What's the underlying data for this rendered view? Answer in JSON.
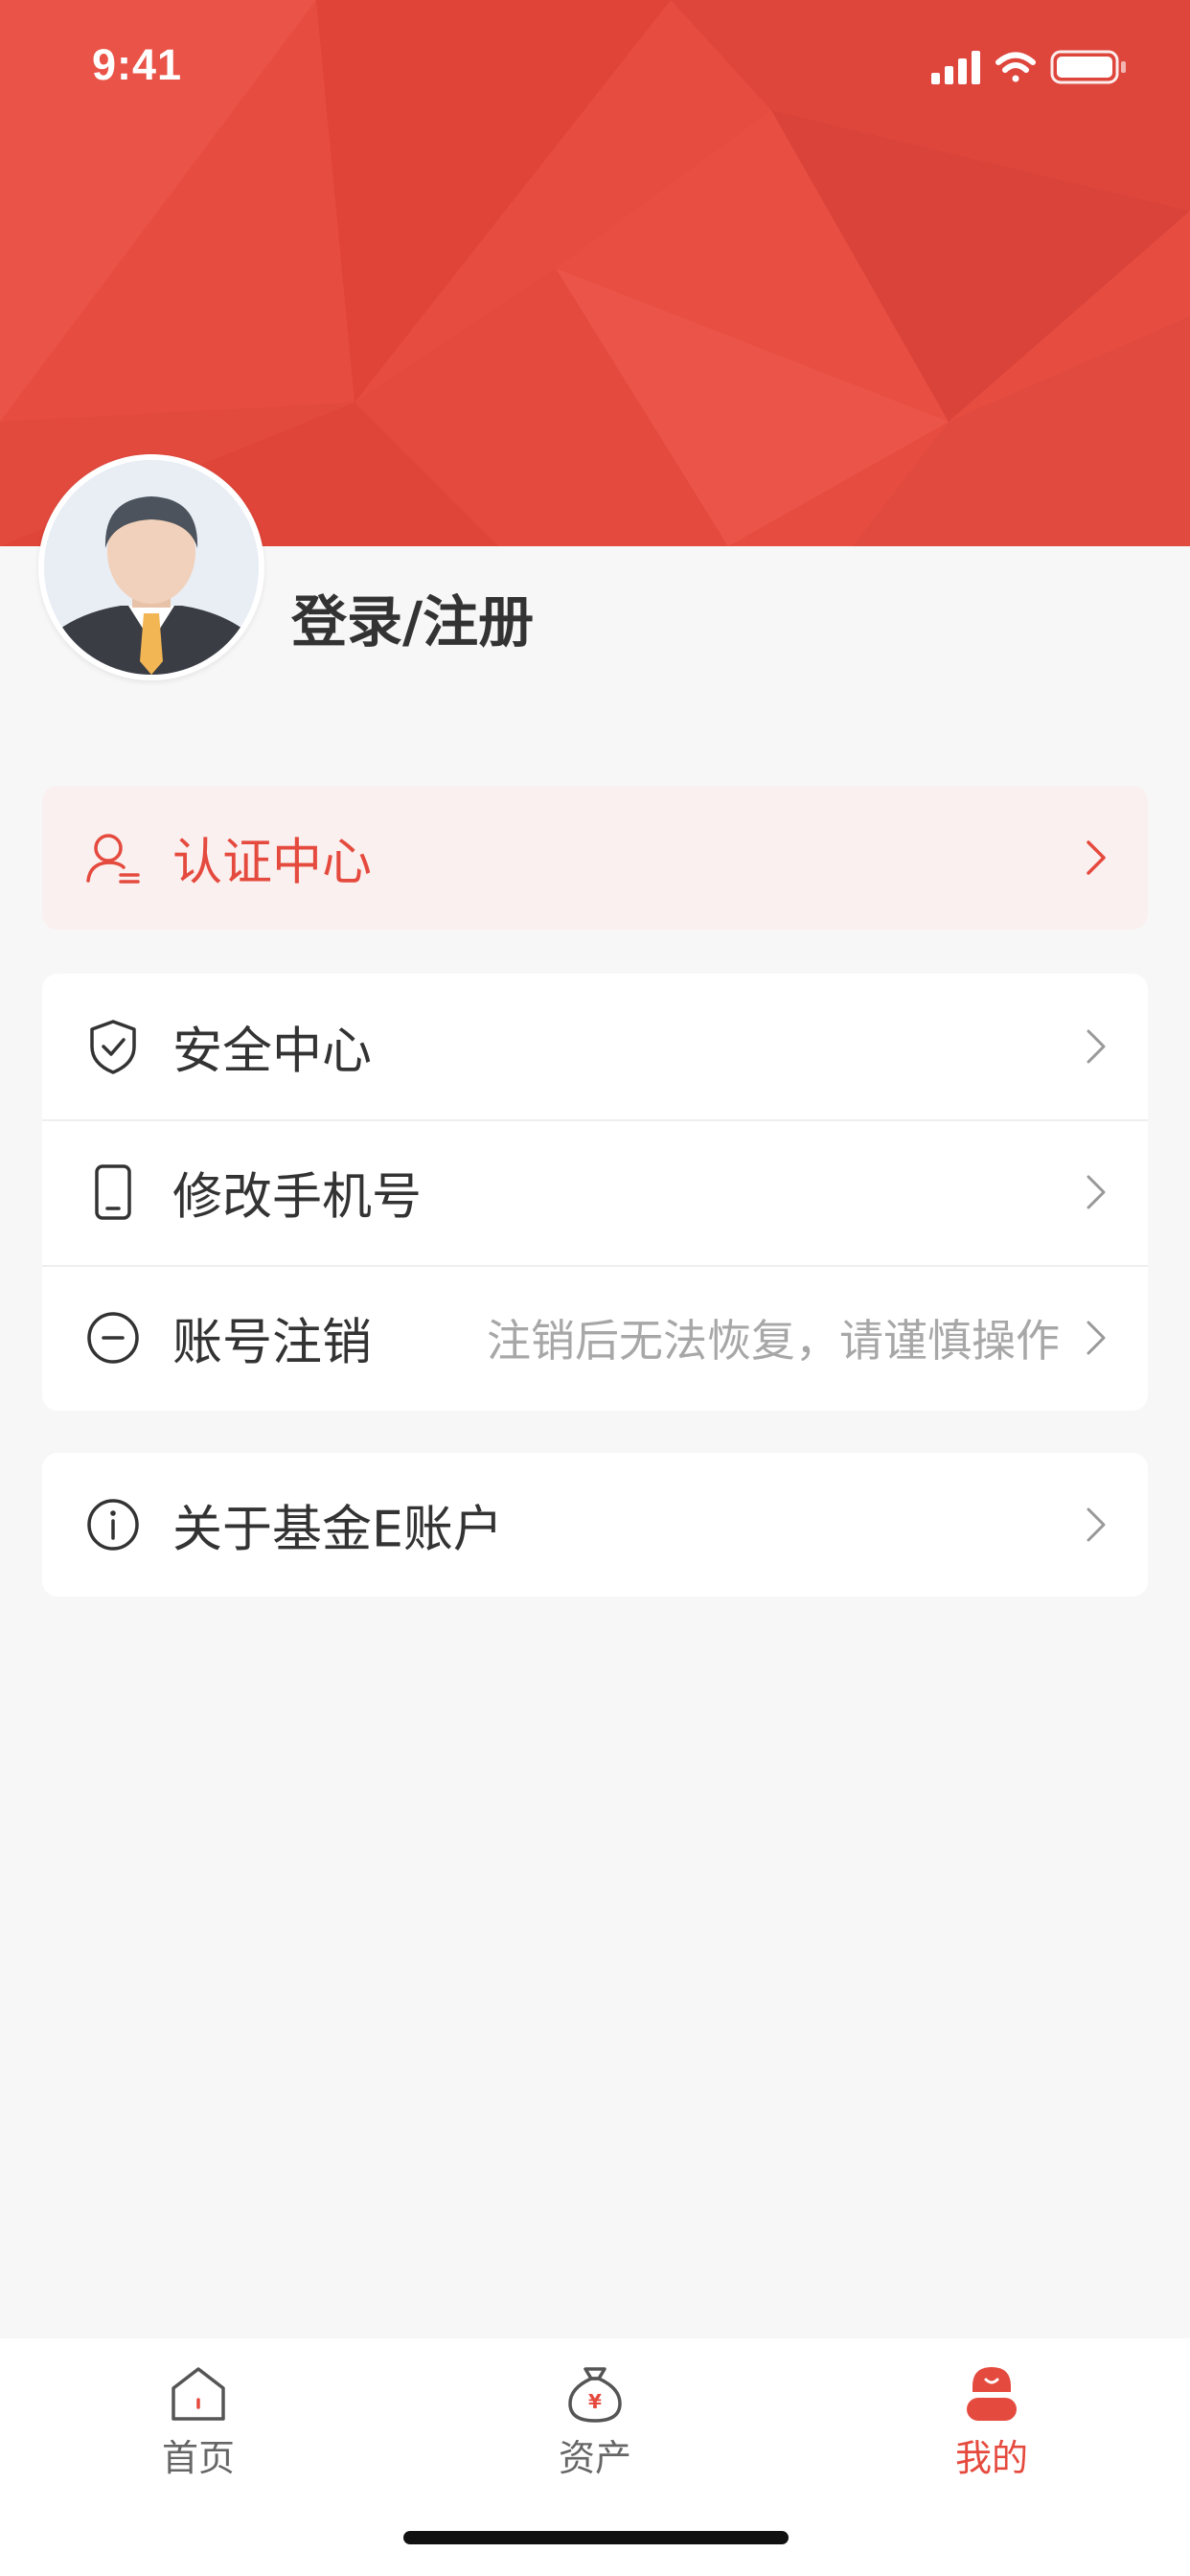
{
  "status_bar": {
    "time": "9:41"
  },
  "colors": {
    "brand_red": "#e74c40",
    "accent_text": "#e54a3e",
    "hint_gray": "#a7a7a7"
  },
  "profile": {
    "login_label": "登录/注册"
  },
  "cert_center": {
    "label": "认证中心",
    "icon": "user-verify-icon"
  },
  "menu_group_1": [
    {
      "label": "安全中心",
      "icon": "shield-check-icon"
    },
    {
      "label": "修改手机号",
      "icon": "phone-icon"
    },
    {
      "label": "账号注销",
      "icon": "minus-circle-icon",
      "hint": "注销后无法恢复，请谨慎操作"
    }
  ],
  "menu_group_2": [
    {
      "label": "关于基金E账户",
      "icon": "info-icon"
    }
  ],
  "tabbar": [
    {
      "label": "首页",
      "icon": "home-icon",
      "active": false
    },
    {
      "label": "资产",
      "icon": "money-bag-icon",
      "active": false
    },
    {
      "label": "我的",
      "icon": "profile-icon",
      "active": true
    }
  ]
}
